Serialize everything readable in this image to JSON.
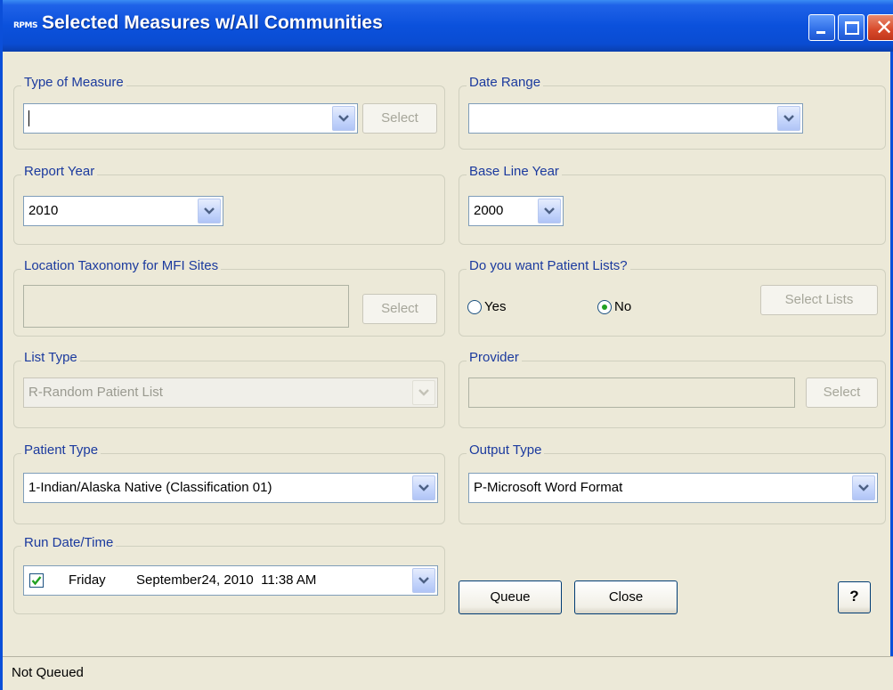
{
  "window": {
    "title": "Selected Measures w/All Communities",
    "icon_text": "RPMS"
  },
  "type_of_measure": {
    "legend": "Type of Measure",
    "value": "",
    "select_label": "Select"
  },
  "date_range": {
    "legend": "Date Range",
    "value": ""
  },
  "report_year": {
    "legend": "Report Year",
    "value": "2010"
  },
  "base_line_year": {
    "legend": "Base Line Year",
    "value": "2000"
  },
  "location_taxonomy": {
    "legend": "Location Taxonomy for MFI Sites",
    "value": "",
    "select_label": "Select"
  },
  "patient_lists": {
    "legend": "Do you want Patient Lists?",
    "yes_label": "Yes",
    "no_label": "No",
    "selected": "No",
    "select_lists_label": "Select Lists"
  },
  "list_type": {
    "legend": "List Type",
    "value": "R-Random Patient List"
  },
  "provider": {
    "legend": "Provider",
    "value": "",
    "select_label": "Select"
  },
  "patient_type": {
    "legend": "Patient Type",
    "value": "1-Indian/Alaska Native (Classification 01)"
  },
  "output_type": {
    "legend": "Output Type",
    "value": "P-Microsoft Word Format"
  },
  "run_datetime": {
    "legend": "Run Date/Time",
    "checked": true,
    "day": "Friday",
    "date": "September24, 2010  11:38 AM"
  },
  "actions": {
    "queue_label": "Queue",
    "close_label": "Close",
    "help_label": "?"
  },
  "status": {
    "text": "Not Queued"
  },
  "colors": {
    "titlebar": "#0b51dc",
    "legend_text": "#1b3a9e",
    "background": "#ece9d8"
  }
}
